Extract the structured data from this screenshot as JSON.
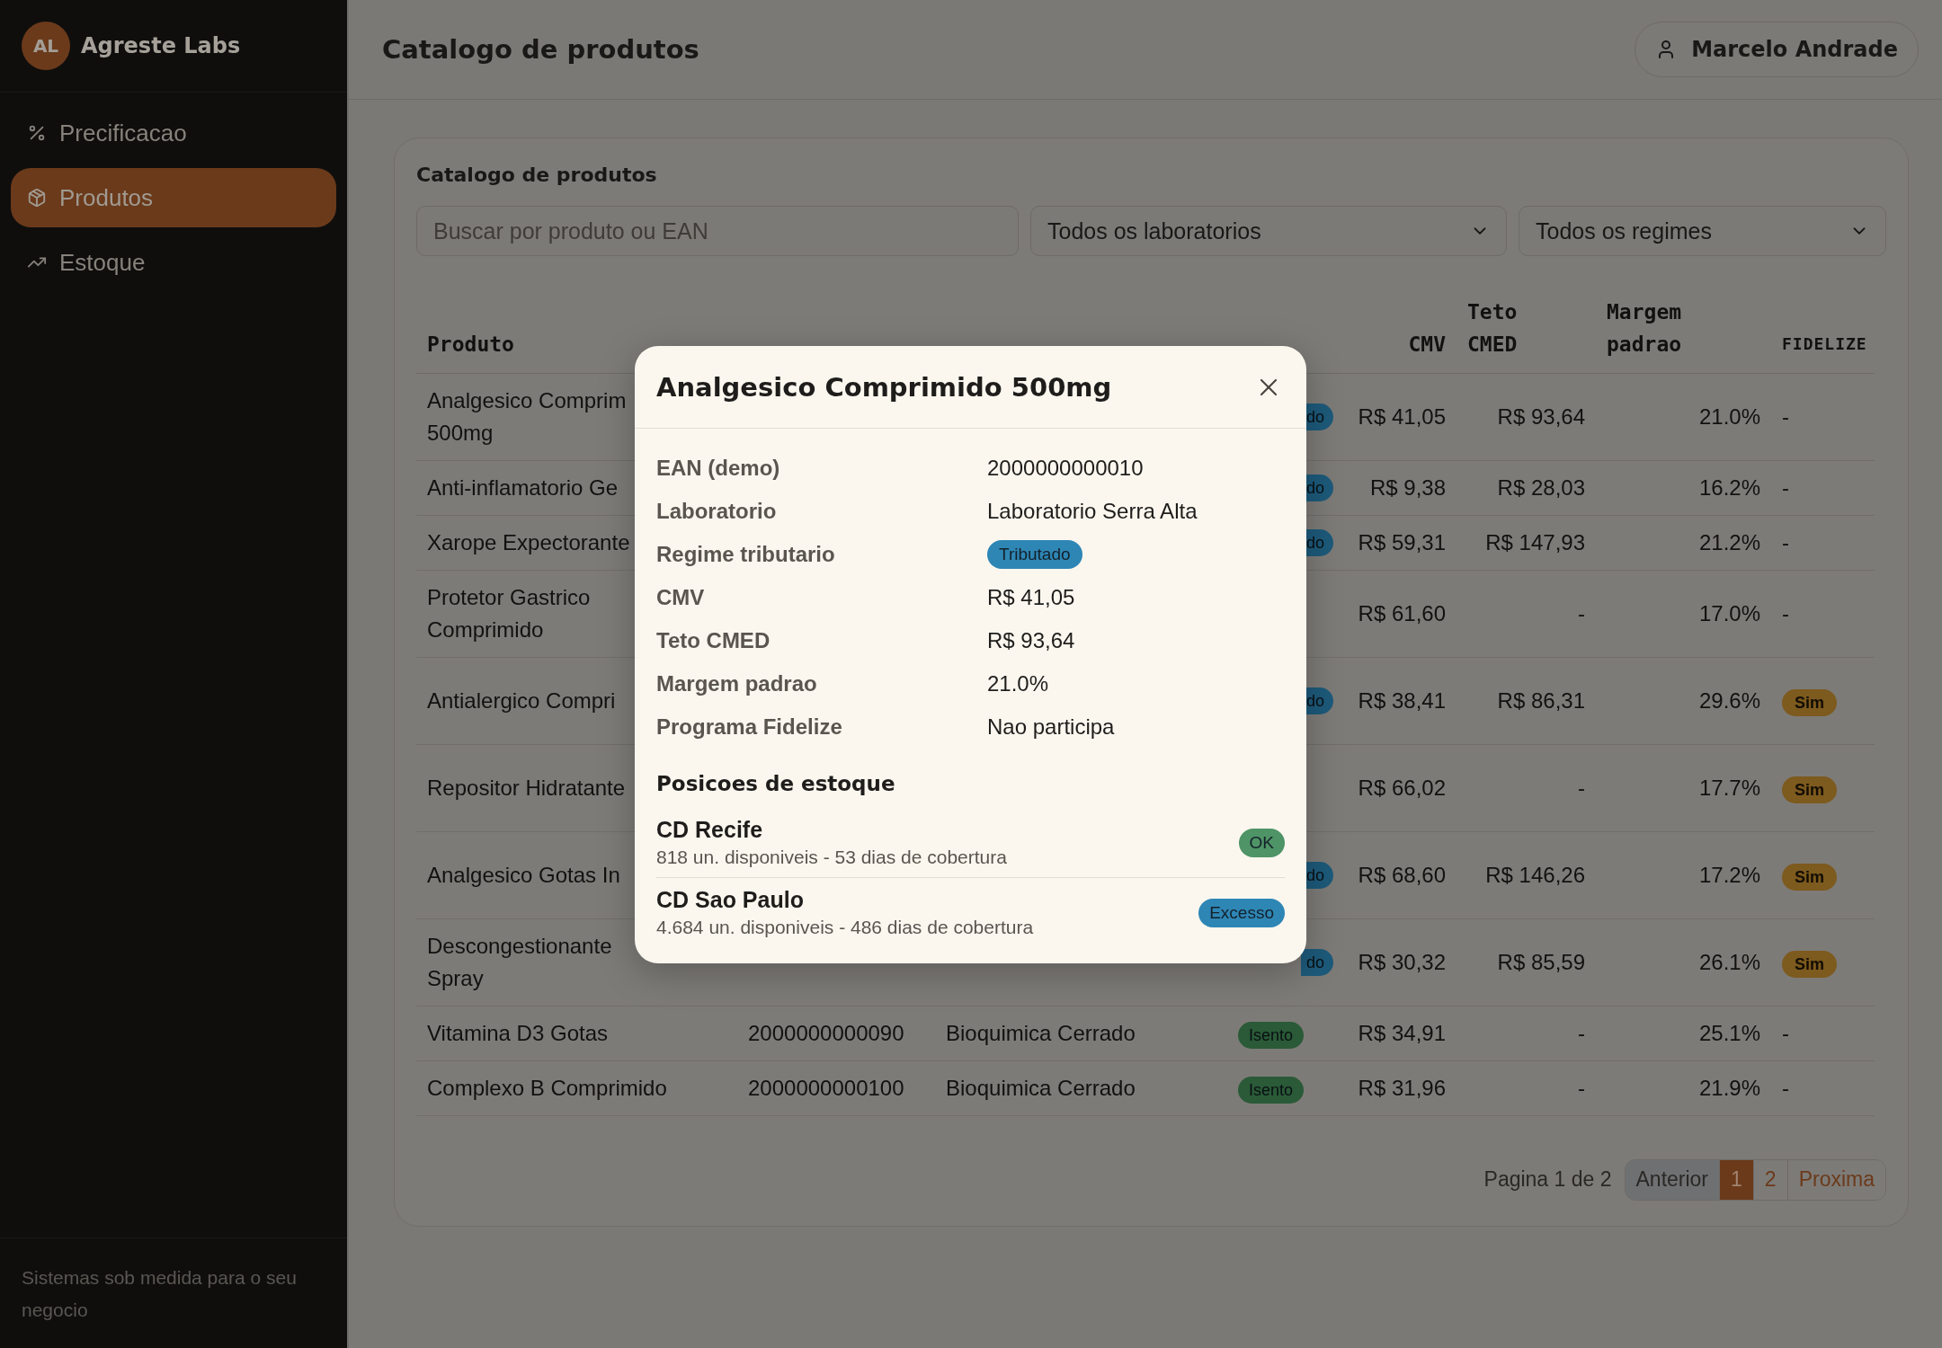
{
  "sidebar": {
    "brand": {
      "initials": "AL",
      "name": "Agreste Labs"
    },
    "items": [
      {
        "label": "Precificacao",
        "selected": false
      },
      {
        "label": "Produtos",
        "selected": true
      },
      {
        "label": "Estoque",
        "selected": false
      }
    ],
    "footer": "Sistemas sob medida para o seu negocio"
  },
  "header": {
    "title": "Catalogo de produtos",
    "user": "Marcelo Andrade"
  },
  "catalog": {
    "title": "Catalogo de produtos",
    "search": {
      "placeholder": "Buscar por produto ou EAN"
    },
    "filters": [
      {
        "value": "Todos os laboratorios"
      },
      {
        "value": "Todos os regimes"
      }
    ],
    "table": {
      "headers": {
        "product": "Produto",
        "cmv": "CMV",
        "teto": "Teto\nCMED",
        "margem": "Margem\npadrao",
        "fidelize": "FIDELIZE"
      },
      "rows": [
        {
          "product": "Analgesico Comprim\n500mg",
          "regime": {
            "text": "do",
            "color": "#1d5a7a",
            "cut": true
          },
          "cmv": "R$ 41,05",
          "teto": "R$ 93,64",
          "margem": "21.0%",
          "fidelize": {
            "kind": "text",
            "text": "-"
          }
        },
        {
          "product": "Anti-inflamatorio Ge",
          "regime": {
            "text": "do",
            "color": "#1d5a7a",
            "cut": true
          },
          "cmv": "R$ 9,38",
          "teto": "R$ 28,03",
          "margem": "16.2%",
          "fidelize": {
            "kind": "text",
            "text": "-"
          }
        },
        {
          "product": "Xarope Expectorante",
          "regime": {
            "text": "do",
            "color": "#1d5a7a",
            "cut": true
          },
          "cmv": "R$ 59,31",
          "teto": "R$ 147,93",
          "margem": "21.2%",
          "fidelize": {
            "kind": "text",
            "text": "-"
          }
        },
        {
          "product": "Protetor Gastrico\nComprimido",
          "cmv": "R$ 61,60",
          "teto": "-",
          "margem": "17.0%",
          "fidelize": {
            "kind": "text",
            "text": "-"
          }
        },
        {
          "product": "Antialergico Compri",
          "regime": {
            "text": "do",
            "color": "#1d5a7a",
            "cut": true
          },
          "cmv": "R$ 38,41",
          "teto": "R$ 86,31",
          "margem": "29.6%",
          "fidelize": {
            "kind": "badge",
            "text": "Sim"
          }
        },
        {
          "product": "Repositor Hidratante",
          "cmv": "R$ 66,02",
          "teto": "-",
          "margem": "17.7%",
          "fidelize": {
            "kind": "badge",
            "text": "Sim"
          }
        },
        {
          "product": "Analgesico Gotas In",
          "regime": {
            "text": "do",
            "color": "#1d5a7a",
            "cut": true
          },
          "cmv": "R$ 68,60",
          "teto": "R$ 146,26",
          "margem": "17.2%",
          "fidelize": {
            "kind": "badge",
            "text": "Sim"
          }
        },
        {
          "product": "Descongestionante\nSpray",
          "regime": {
            "text": "do",
            "color": "#1d5a7a",
            "cut": true
          },
          "cmv": "R$ 30,32",
          "teto": "R$ 85,59",
          "margem": "26.1%",
          "fidelize": {
            "kind": "badge",
            "text": "Sim"
          }
        },
        {
          "product": "Vitamina D3 Gotas",
          "ean": "2000000000090",
          "lab": "Bioquimica Cerrado",
          "regime": {
            "text": "Isento",
            "color": "#2a5a37",
            "cut": false
          },
          "cmv": "R$ 34,91",
          "teto": "-",
          "margem": "25.1%",
          "fidelize": {
            "kind": "text",
            "text": "-"
          }
        },
        {
          "product": "Complexo B Comprimido",
          "ean": "2000000000100",
          "lab": "Bioquimica Cerrado",
          "regime": {
            "text": "Isento",
            "color": "#2a5a37",
            "cut": false
          },
          "cmv": "R$ 31,96",
          "teto": "-",
          "margem": "21.9%",
          "fidelize": {
            "kind": "text",
            "text": "-"
          }
        }
      ]
    },
    "pagination": {
      "summary": "Pagina 1 de 2",
      "prev": {
        "label": "Anterior",
        "disabled": true
      },
      "pages": [
        {
          "label": "1",
          "selected": true
        },
        {
          "label": "2",
          "selected": false
        }
      ],
      "next": {
        "label": "Proxima",
        "disabled": false
      }
    }
  },
  "modal": {
    "title": "Analgesico Comprimido 500mg",
    "details": [
      {
        "label": "EAN (demo)",
        "kind": "text",
        "value": "2000000000010"
      },
      {
        "label": "Laboratorio",
        "kind": "text",
        "value": "Laboratorio Serra Alta"
      },
      {
        "label": "Regime tributario",
        "kind": "badge",
        "value": "Tributado",
        "color": "#2e86b5"
      },
      {
        "label": "CMV",
        "kind": "text",
        "value": "R$ 41,05"
      },
      {
        "label": "Teto CMED",
        "kind": "text",
        "value": "R$ 93,64"
      },
      {
        "label": "Margem padrao",
        "kind": "text",
        "value": "21.0%"
      },
      {
        "label": "Programa Fidelize",
        "kind": "text",
        "value": "Nao participa"
      }
    ],
    "stock_title": "Posicoes de estoque",
    "stock": [
      {
        "name": "CD Recife",
        "info": "818 un. disponiveis - 53 dias de cobertura",
        "status": "OK",
        "color": "#4f9466"
      },
      {
        "name": "CD Sao Paulo",
        "info": "4.684 un. disponiveis - 486 dias de cobertura",
        "status": "Excesso",
        "color": "#2e86b5"
      }
    ]
  }
}
